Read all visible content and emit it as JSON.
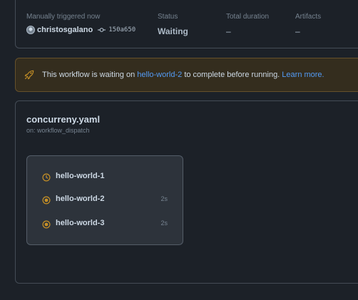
{
  "summary": {
    "trigger_label": "Manually triggered now",
    "actor": "christosgalano",
    "commit_sha": "150a650",
    "status_label": "Status",
    "status_value": "Waiting",
    "duration_label": "Total duration",
    "duration_value": "–",
    "artifacts_label": "Artifacts",
    "artifacts_value": "–"
  },
  "banner": {
    "prefix": "This workflow is waiting on ",
    "link_text": "hello-world-2",
    "middle": " to complete before running. ",
    "learn_more": "Learn more."
  },
  "workflow": {
    "file_name": "concurreny.yaml",
    "trigger": "on: workflow_dispatch",
    "jobs": [
      {
        "name": "hello-world-1",
        "duration": "",
        "status_icon": "clock-icon"
      },
      {
        "name": "hello-world-2",
        "duration": "2s",
        "status_icon": "in-progress-icon"
      },
      {
        "name": "hello-world-3",
        "duration": "2s",
        "status_icon": "in-progress-icon"
      }
    ]
  },
  "colors": {
    "background": "#1c2128",
    "waiting_accent": "#c69026",
    "link": "#539bf5",
    "banner_bg": "#342d1e",
    "banner_border": "#66512b"
  }
}
